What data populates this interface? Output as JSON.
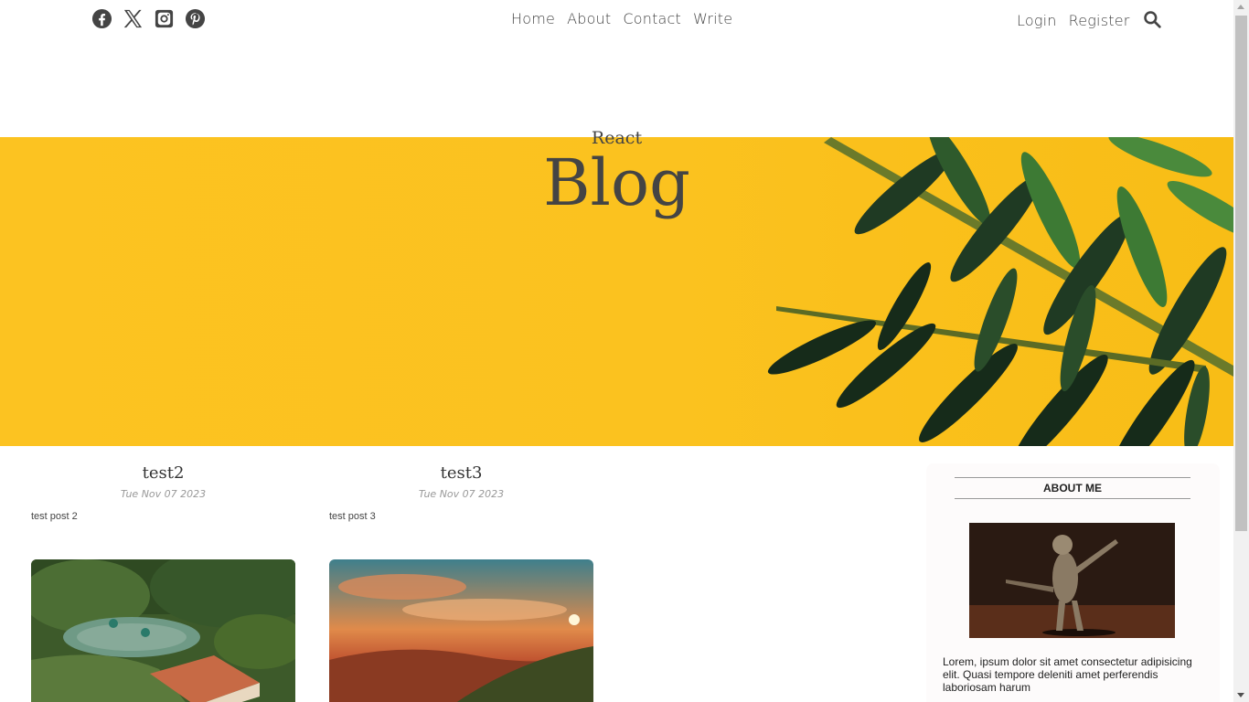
{
  "topbar": {
    "social": [
      {
        "icon": "facebook-icon"
      },
      {
        "icon": "x-twitter-icon"
      },
      {
        "icon": "instagram-icon"
      },
      {
        "icon": "pinterest-icon"
      }
    ],
    "nav": [
      "Home",
      "About",
      "Contact",
      "Write"
    ],
    "auth": [
      "Login",
      "Register"
    ],
    "search_icon": "search-icon"
  },
  "header": {
    "small_title": "React",
    "large_title": "Blog",
    "banner_color": "#fcc321"
  },
  "posts": [
    {
      "title": "test2",
      "date": "Tue Nov 07 2023",
      "desc": "test post 2"
    },
    {
      "title": "test3",
      "date": "Tue Nov 07 2023",
      "desc": "test post 3"
    }
  ],
  "sidebar": {
    "title": "ABOUT ME",
    "text": "Lorem, ipsum dolor sit amet consectetur adipisicing elit. Quasi tempore deleniti amet perferendis laboriosam harum"
  }
}
